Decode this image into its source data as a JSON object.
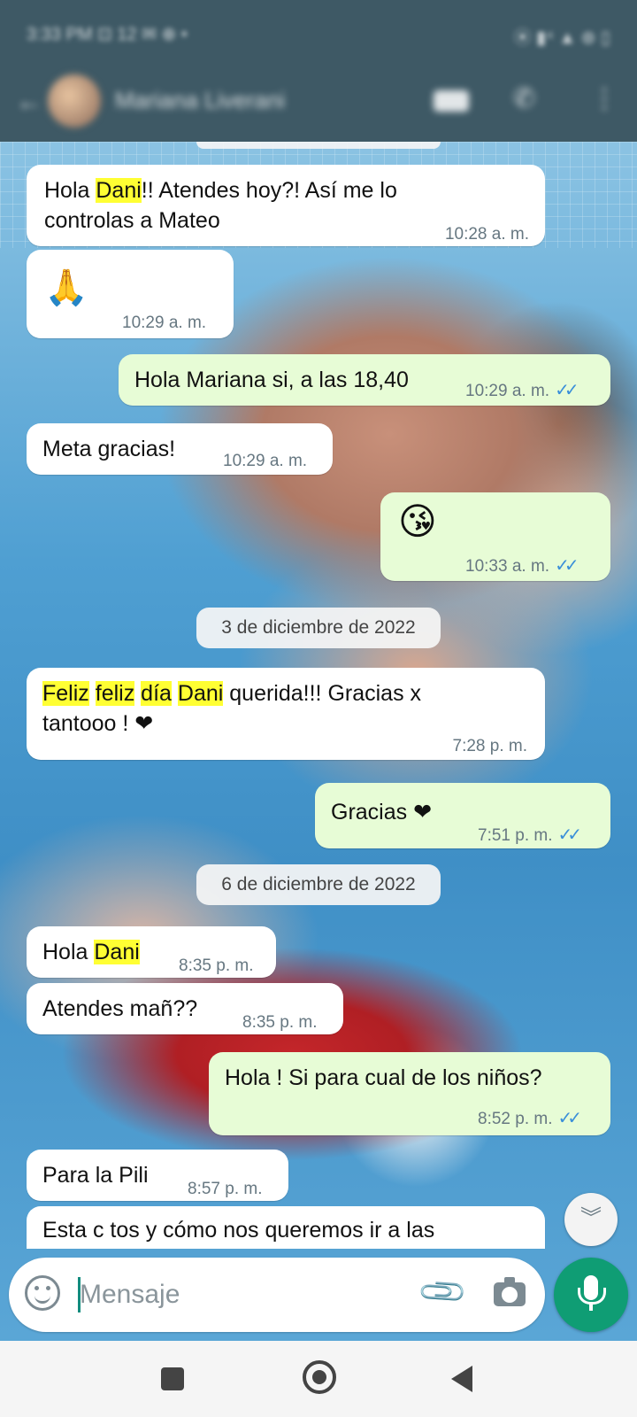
{
  "status_bar": {
    "left": "3:33 PM ⊡ 12 ✉ ⊕ •",
    "right": "⦿ ▮⁴ ▲ ⊛ ▯"
  },
  "header": {
    "contact_name": "Mariana Liverani",
    "icons": [
      "back-icon",
      "avatar",
      "video-call-icon",
      "phone-icon",
      "menu-icon"
    ]
  },
  "messages": [
    {
      "dir": "in",
      "parts": [
        [
          "Hola ",
          false
        ],
        [
          "Dani",
          true
        ],
        [
          "!! Atendes hoy?! Así me lo",
          false
        ]
      ],
      "line2": "controlas a Mateo",
      "time": "10:28 a. m."
    },
    {
      "dir": "in",
      "emoji": "🙏",
      "time": "10:29 a. m."
    },
    {
      "dir": "out",
      "text": "Hola Mariana si, a las 18,40",
      "time": "10:29 a. m.",
      "ticks": "✓✓"
    },
    {
      "dir": "in",
      "text": "Meta gracias!",
      "time": "10:29 a. m."
    },
    {
      "dir": "out",
      "emoji": "😘",
      "time": "10:33 a. m.",
      "ticks": "✓✓"
    },
    {
      "dir": "in",
      "line1_parts": [
        [
          "Feliz",
          true
        ],
        [
          " ",
          false
        ],
        [
          "feliz",
          true
        ],
        [
          " ",
          false
        ],
        [
          "día",
          true
        ],
        [
          " ",
          false
        ],
        [
          "Dani",
          true
        ],
        [
          " querida!!! Gracias x",
          false
        ]
      ],
      "line2": "tantooo ! ❤",
      "time": "7:28 p. m."
    },
    {
      "dir": "out",
      "text": "Gracias ❤",
      "time": "7:51 p. m.",
      "ticks": "✓✓"
    },
    {
      "dir": "in",
      "parts": [
        [
          "Hola ",
          false
        ],
        [
          "Dani",
          true
        ]
      ],
      "time": "8:35 p. m."
    },
    {
      "dir": "in",
      "text": "Atendes mañ??",
      "time": "8:35 p. m."
    },
    {
      "dir": "out",
      "text": "Hola ! Si para cual de los niños?",
      "time": "8:52 p. m.",
      "ticks": "✓✓"
    },
    {
      "dir": "in",
      "text": "Para la Pili",
      "time": "8:57 p. m."
    },
    {
      "dir": "in",
      "text": "Esta c tos y cómo nos queremos ir a las"
    }
  ],
  "date_chips": {
    "first": "3 de diciembre de 2022",
    "second": "6 de diciembre de 2022"
  },
  "input": {
    "placeholder": "Mensaje"
  },
  "colors": {
    "header": "#3e5965",
    "outgoing_bubble": "#e7fcd6",
    "incoming_bubble": "#ffffff",
    "accent": "#0f9d74",
    "read_ticks": "#3a8fd9",
    "highlight": "#ffff33"
  }
}
